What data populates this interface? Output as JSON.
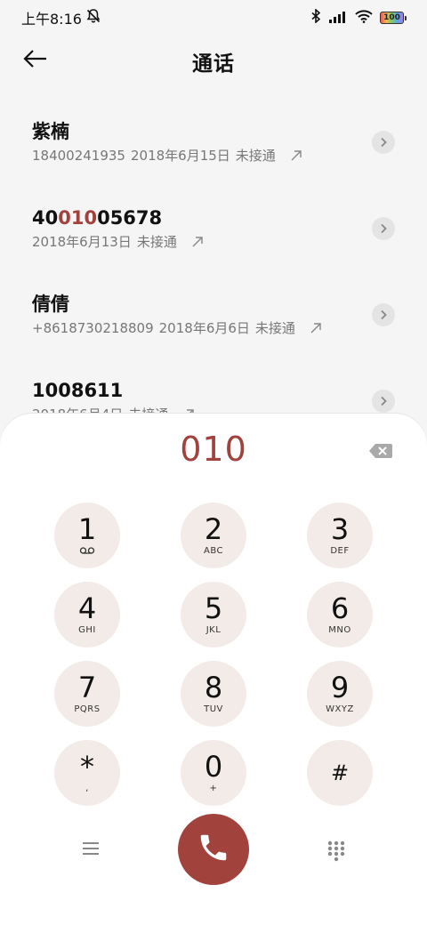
{
  "status_bar": {
    "time": "上午8:16",
    "battery": "100"
  },
  "header": {
    "title": "通话"
  },
  "calls": [
    {
      "name": "紫楠",
      "name_pre": "",
      "name_hl": "",
      "name_post": "紫楠",
      "number": "18400241935",
      "date": "2018年6月15日",
      "status": "未接通"
    },
    {
      "name": "4001005678",
      "name_pre": "40",
      "name_hl": "010",
      "name_post": "05678",
      "number": "",
      "date": "2018年6月13日",
      "status": "未接通"
    },
    {
      "name": "倩倩",
      "name_pre": "",
      "name_hl": "",
      "name_post": "倩倩",
      "number": "+8618730218809",
      "date": "2018年6月6日",
      "status": "未接通"
    },
    {
      "name": "1008611",
      "name_pre": "",
      "name_hl": "",
      "name_post": "1008611",
      "number": "",
      "date": "2018年6月4日",
      "status": "未接通"
    }
  ],
  "dialer": {
    "input": "010",
    "keys": [
      {
        "digit": "1",
        "letters": ""
      },
      {
        "digit": "2",
        "letters": "ABC"
      },
      {
        "digit": "3",
        "letters": "DEF"
      },
      {
        "digit": "4",
        "letters": "GHI"
      },
      {
        "digit": "5",
        "letters": "JKL"
      },
      {
        "digit": "6",
        "letters": "MNO"
      },
      {
        "digit": "7",
        "letters": "PQRS"
      },
      {
        "digit": "8",
        "letters": "TUV"
      },
      {
        "digit": "9",
        "letters": "WXYZ"
      },
      {
        "digit": "*",
        "letters": ","
      },
      {
        "digit": "0",
        "letters": "+"
      },
      {
        "digit": "#",
        "letters": ""
      }
    ]
  },
  "colors": {
    "accent": "#a2423d",
    "key_bg": "#f3ebe7"
  },
  "icons": {
    "back": "arrow-left-icon",
    "detail": "chevron-right-icon",
    "outgoing": "outgoing-call-arrow-icon",
    "backspace": "backspace-icon",
    "voicemail": "voicemail-icon",
    "menu": "menu-icon",
    "call": "phone-icon",
    "keypad": "dialpad-icon"
  }
}
